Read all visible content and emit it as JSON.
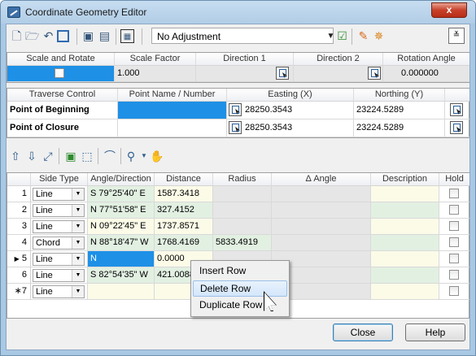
{
  "window": {
    "title": "Coordinate Geometry Editor",
    "close_glyph": "x"
  },
  "toolbar": {
    "adjustment_value": "No Adjustment",
    "icons": [
      "new-icon",
      "open-icon",
      "undo-icon",
      "rectangle-icon",
      "save-icon",
      "save-as-icon",
      "grid-icon",
      "accept-icon",
      "sketch-icon",
      "settings-icon"
    ],
    "collapse_glyph": "≚"
  },
  "scale_panel": {
    "headers": [
      "Scale and Rotate",
      "Scale Factor",
      "Direction 1",
      "Direction 2",
      "Rotation Angle"
    ],
    "scale_factor": "1.000",
    "rotation_angle": "0.000000"
  },
  "traverse_panel": {
    "headers": [
      "Traverse Control",
      "Point Name / Number",
      "Easting (X)",
      "Northing (Y)"
    ],
    "rows": [
      {
        "label": "Point of Beginning",
        "point": "",
        "easting": "28250.3543",
        "northing": "23224.5289"
      },
      {
        "label": "Point of Closure",
        "point": "",
        "easting": "28250.3543",
        "northing": "23224.5289"
      }
    ]
  },
  "grid": {
    "headers": [
      "Side Type",
      "Angle/Direction",
      "Distance",
      "Radius",
      "Δ Angle",
      "Description",
      "Hold"
    ],
    "rows": [
      {
        "num": "1",
        "type": "Line",
        "dir": "S 79°25'40\" E",
        "dist": "1587.3418",
        "radius": "",
        "delta": "",
        "desc": ""
      },
      {
        "num": "2",
        "type": "Line",
        "dir": "N 77°51'58\" E",
        "dist": "327.4152",
        "radius": "",
        "delta": "",
        "desc": ""
      },
      {
        "num": "3",
        "type": "Line",
        "dir": "N 09°22'45\" E",
        "dist": "1737.8571",
        "radius": "",
        "delta": "",
        "desc": ""
      },
      {
        "num": "4",
        "type": "Chord",
        "dir": "N 88°18'47\" W",
        "dist": "1768.4169",
        "radius": "5833.4919",
        "delta": "",
        "desc": ""
      },
      {
        "num": "5",
        "type": "Line",
        "dir": "N",
        "dist": "0.0000",
        "radius": "",
        "delta": "",
        "desc": ""
      },
      {
        "num": "6",
        "type": "Line",
        "dir": "S 82°54'35\" W",
        "dist": "421.0088",
        "radius": "",
        "delta": "",
        "desc": ""
      },
      {
        "num": "7",
        "type": "Line",
        "dir": "",
        "dist": "",
        "radius": "",
        "delta": "",
        "desc": ""
      }
    ],
    "current_marker": "▶",
    "new_marker": "∗"
  },
  "context_menu": {
    "items": [
      "Insert Row",
      "Delete Row",
      "Duplicate Row"
    ]
  },
  "buttons": {
    "close": "Close",
    "help": "Help"
  }
}
